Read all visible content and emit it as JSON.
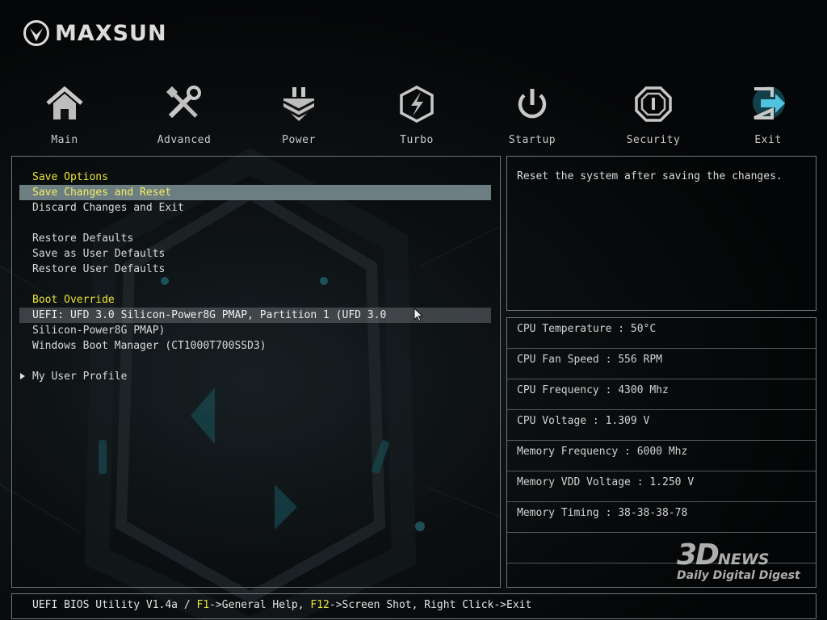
{
  "brand": {
    "name": "MAXSUN"
  },
  "nav": {
    "tabs": [
      {
        "label": "Main",
        "icon": "home-icon"
      },
      {
        "label": "Advanced",
        "icon": "tools-icon"
      },
      {
        "label": "Power",
        "icon": "power-plug-icon"
      },
      {
        "label": "Turbo",
        "icon": "turbo-bolt-icon"
      },
      {
        "label": "Startup",
        "icon": "power-button-icon"
      },
      {
        "label": "Security",
        "icon": "shield-icon"
      },
      {
        "label": "Exit",
        "icon": "exit-door-icon"
      }
    ],
    "active": "Exit"
  },
  "menu": {
    "save_options": "Save Options",
    "save_changes_reset": "Save Changes and Reset",
    "discard_changes_exit": "Discard Changes and Exit",
    "restore_defaults": "Restore Defaults",
    "save_user_defaults": "Save as User Defaults",
    "restore_user_defaults": "Restore User Defaults",
    "boot_override": "Boot Override",
    "boot_uefi_ufd": "UEFI: UFD 3.0 Silicon-Power8G PMAP, Partition 1 (UFD 3.0",
    "boot_uefi_ufd_cont": "Silicon-Power8G PMAP)",
    "boot_windows": "Windows Boot Manager (CT1000T700SSD3)",
    "my_user_profile": "My User Profile"
  },
  "help": {
    "text": "Reset the system after saving the changes."
  },
  "stats": {
    "cpu_temperature": "CPU Temperature : 50°C",
    "cpu_fan_speed": "CPU Fan Speed : 556 RPM",
    "cpu_frequency": "CPU Frequency : 4300 Mhz",
    "cpu_voltage": "CPU Voltage : 1.309 V",
    "memory_frequency": "Memory Frequency : 6000 Mhz",
    "memory_vdd_voltage": "Memory VDD Voltage : 1.250 V",
    "memory_timing": "Memory Timing : 38-38-38-78"
  },
  "footer": {
    "prefix": "UEFI BIOS Utility V1.4a / ",
    "key1": "F1",
    "text1": "->General Help, ",
    "key2": "F12",
    "text2": "->Screen Shot, Right Click->Exit"
  },
  "watermark": {
    "big": "3D",
    "news": "NEWS",
    "sub": "Daily Digital Digest"
  },
  "colors": {
    "highlight_text": "#eae23a",
    "selected_bg": "#6d7e82",
    "border": "#6f7579"
  }
}
